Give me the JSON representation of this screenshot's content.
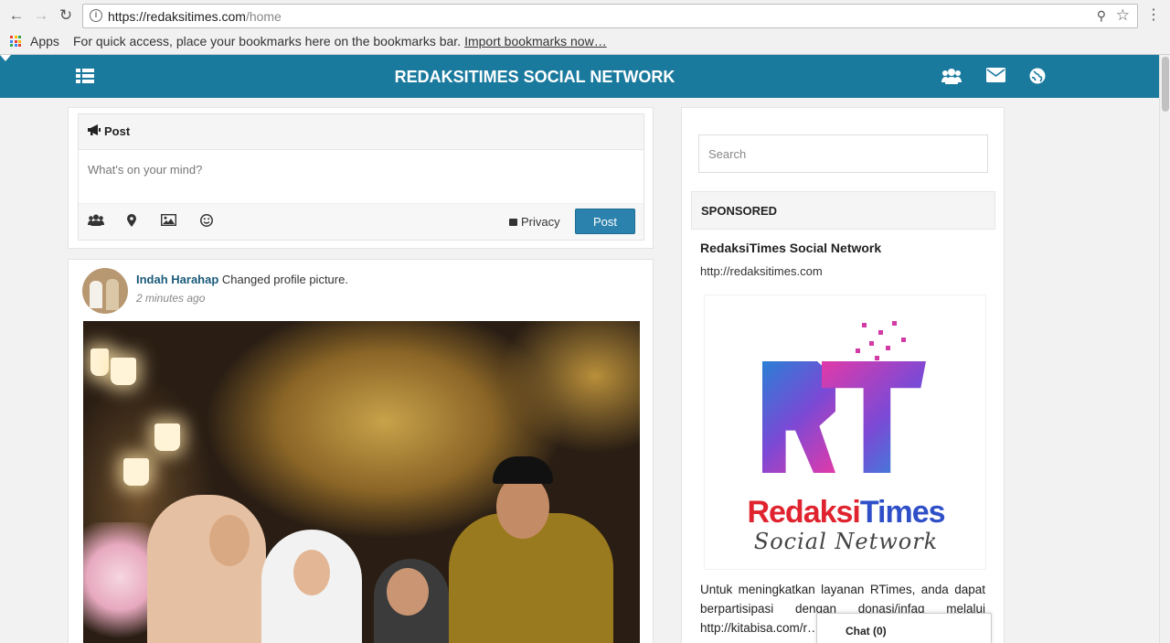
{
  "browser": {
    "url_host": "https://redaksitimes.com",
    "url_path": "/home",
    "bookmarks_apps": "Apps",
    "bookmarks_message": "For quick access, place your bookmarks here on the bookmarks bar.",
    "bookmarks_import": "Import bookmarks now…"
  },
  "header": {
    "title": "REDAKSITIMES SOCIAL NETWORK",
    "color": "#1a7a9e",
    "icons": [
      "menu-icon",
      "groups-icon",
      "mail-icon",
      "globe-icon",
      "caret-down-icon"
    ]
  },
  "composer": {
    "heading": "Post",
    "placeholder": "What's on your mind?",
    "tools": [
      "tag-people-icon",
      "location-icon",
      "photo-icon",
      "emoji-icon"
    ],
    "privacy_label": "Privacy",
    "post_button": "Post",
    "accent": "#2b82ad"
  },
  "feed": {
    "post": {
      "author": "Indah Harahap",
      "action": "Changed profile picture.",
      "time": "2 minutes ago"
    }
  },
  "sidebar": {
    "search_placeholder": "Search",
    "sponsored_heading": "SPONSORED",
    "ad": {
      "title": "RedaksiTimes Social Network",
      "url": "http://redaksitimes.com",
      "logo_mark": "RT",
      "logo_word_a": "Redaksi",
      "logo_word_b": "Times",
      "logo_tagline": "Social Network",
      "body": "Untuk meningkatkan layanan RTimes, anda dapat berpartisipasi dengan donasi/infaq melalui http://kitabisa.com/r… menghubungi…"
    }
  },
  "chat": {
    "label": "Chat (0)"
  }
}
